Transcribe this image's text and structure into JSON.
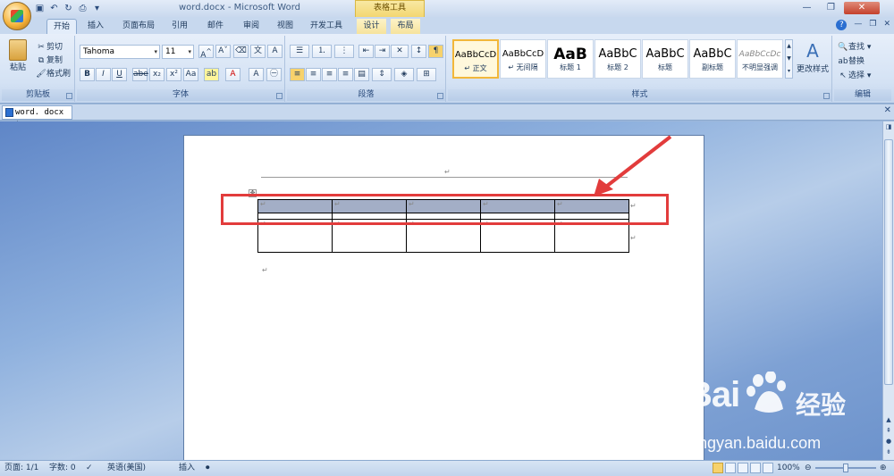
{
  "window": {
    "title": "word.docx - Microsoft Word",
    "context_tab_group": "表格工具"
  },
  "tabs": [
    "开始",
    "插入",
    "页面布局",
    "引用",
    "邮件",
    "审阅",
    "视图",
    "开发工具",
    "设计",
    "布局"
  ],
  "ribbon": {
    "clipboard": {
      "label": "剪贴板",
      "paste": "粘贴",
      "cut": "剪切",
      "copy": "复制",
      "format_painter": "格式刷"
    },
    "font": {
      "label": "字体",
      "font_name": "Tahoma",
      "font_size": "11"
    },
    "paragraph": {
      "label": "段落"
    },
    "styles": {
      "label": "样式",
      "items": [
        {
          "sample": "AaBbCcD",
          "name": "↵ 正文"
        },
        {
          "sample": "AaBbCcD",
          "name": "↵ 无间隔"
        },
        {
          "sample": "AaB",
          "name": "标题 1"
        },
        {
          "sample": "AaBbC",
          "name": "标题 2"
        },
        {
          "sample": "AaBbC",
          "name": "标题"
        },
        {
          "sample": "AaBbC",
          "name": "副标题"
        },
        {
          "sample": "AaBbCcDc",
          "name": "不明显强调"
        }
      ],
      "change_styles": "更改样式"
    },
    "editing": {
      "label": "编辑",
      "find": "查找",
      "replace": "替换",
      "select": "选择"
    }
  },
  "doc_tab": {
    "name": "word. docx *"
  },
  "document": {
    "para_mark": "↵",
    "rows": [
      [
        "↵",
        "↵",
        "↵",
        "↵",
        "↵"
      ],
      [
        "",
        "",
        "",
        "",
        ""
      ],
      [
        "↵",
        "↵",
        "↵",
        "↵",
        "↵"
      ]
    ]
  },
  "watermark": {
    "brand": "Bai",
    "brand_cn": "经验",
    "url": "jingyan.baidu.com"
  },
  "status": {
    "page": "页面: 1/1",
    "words": "字数: 0",
    "language": "英语(美国)",
    "mode": "插入",
    "zoom": "100%"
  },
  "colors": {
    "highlight": "#e23c3c",
    "header_row_fill": "#a3aec6",
    "context_tab": "#f3d771"
  }
}
